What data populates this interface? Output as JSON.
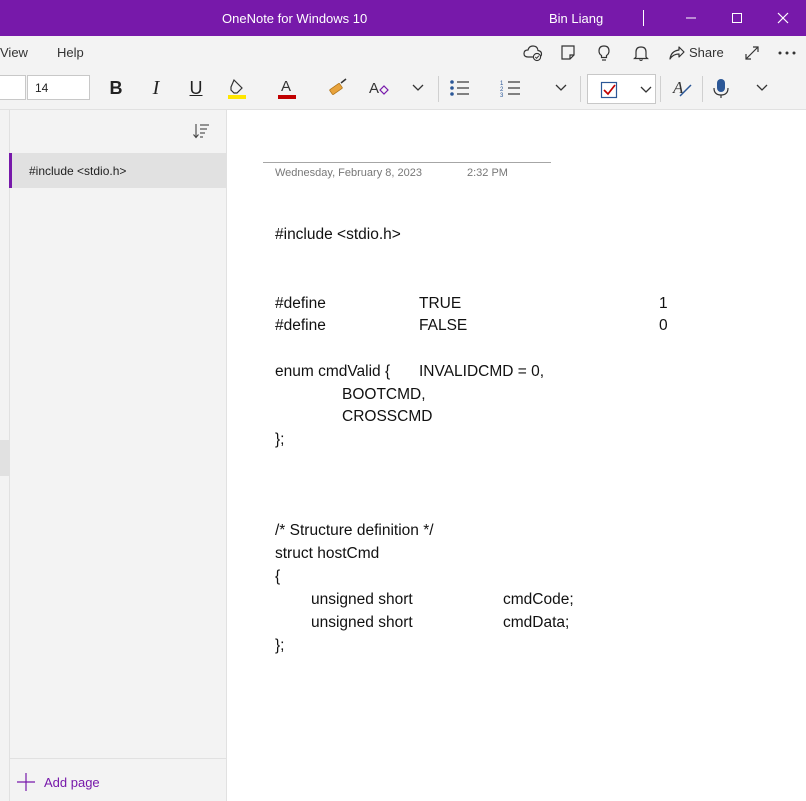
{
  "window": {
    "title": "OneNote for Windows 10",
    "user": "Bin Liang",
    "accent": "#7719aa"
  },
  "menu": {
    "items": [
      "View",
      "Help"
    ],
    "share_label": "Share"
  },
  "ribbon": {
    "font_size": "14",
    "bold": "B",
    "italic": "I",
    "underline": "U",
    "font_color_glyph": "A",
    "highlight_color": "#ffe600",
    "font_color": "#c00000"
  },
  "sidebar": {
    "pages": [
      {
        "title": "#include <stdio.h>",
        "selected": true
      }
    ],
    "add_page_label": "Add page"
  },
  "note": {
    "date": "Wednesday, February 8, 2023",
    "time": "2:32 PM",
    "lines": {
      "include": "#include <stdio.h>",
      "define1": [
        "#define",
        "TRUE",
        "1"
      ],
      "define2": [
        "#define",
        "FALSE",
        "0"
      ],
      "enum_open": [
        "enum cmdValid {",
        "INVALIDCMD = 0,"
      ],
      "enum_item1": "BOOTCMD,",
      "enum_item2": "CROSSCMD",
      "enum_close": "};",
      "comment": "/* Structure definition */",
      "struct": "struct hostCmd",
      "brace_open": "{",
      "field1": [
        "unsigned short",
        "cmdCode;"
      ],
      "field2": [
        "unsigned short",
        "cmdData;"
      ],
      "brace_close": "};"
    }
  }
}
